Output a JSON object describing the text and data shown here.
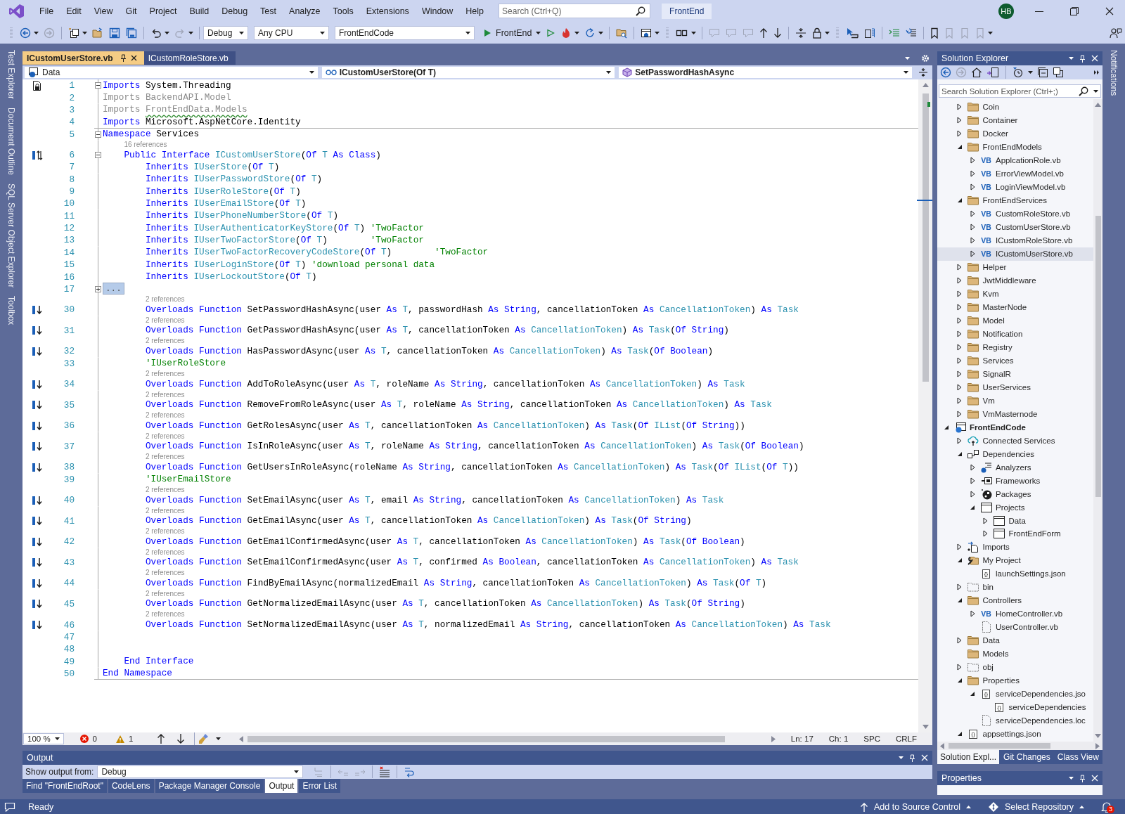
{
  "menu": [
    "File",
    "Edit",
    "View",
    "Git",
    "Project",
    "Build",
    "Debug",
    "Test",
    "Analyze",
    "Tools",
    "Extensions",
    "Window",
    "Help"
  ],
  "search": {
    "placeholder": "Search (Ctrl+Q)"
  },
  "solution_name": "FrontEnd",
  "user_initials": "HB",
  "toolbar": {
    "configuration": "Debug",
    "platform": "Any CPU",
    "startup_project": "FrontEndCode",
    "run_label": "FrontEnd"
  },
  "left_tool_tabs": [
    "Test Explorer",
    "Document Outline",
    "SQL Server Object Explorer",
    "Toolbox"
  ],
  "right_tool_tabs": [
    "Notifications"
  ],
  "document_tabs": [
    {
      "label": "ICustomUserStore.vb",
      "selected": true
    },
    {
      "label": "ICustomRoleStore.vb",
      "selected": false
    }
  ],
  "navigation_bar": {
    "project": "Data",
    "type": "ICustomUserStore(Of T)",
    "member": "SetPasswordHashAsync"
  },
  "code_lines": [
    {
      "number": "1",
      "margin_glyph": {
        "kind": "page-lock"
      },
      "expanded": true,
      "tokens": [
        {
          "kind": "keyword",
          "text": "Imports"
        },
        {
          "kind": "plain",
          "text": " System.Threading"
        }
      ]
    },
    {
      "number": "2",
      "tokens": [
        {
          "kind": "unused",
          "text": "Imports BackendAPI.Model"
        }
      ]
    },
    {
      "number": "3",
      "tokens": [
        {
          "kind": "unused",
          "text": "Imports "
        },
        {
          "kind": "unused-squiggle",
          "text": "FrontEndData.Models"
        }
      ]
    },
    {
      "number": "4",
      "tokens": [
        {
          "kind": "keyword",
          "text": "Imports"
        },
        {
          "kind": "plain",
          "text": " Microsoft.AspNetCore.Identity"
        }
      ]
    },
    {
      "number": "5",
      "expanded": true,
      "divider_above": true,
      "tokens": [
        {
          "kind": "keyword",
          "text": "Namespace"
        },
        {
          "kind": "plain",
          "text": " Services"
        }
      ]
    },
    {
      "number": "6",
      "references": "16 references",
      "margin_glyph": {
        "kind": "up-down"
      },
      "expanded": true,
      "tokens": [
        {
          "kind": "keyword",
          "text": "    Public Interface "
        },
        {
          "kind": "type",
          "text": "ICustomUserStore"
        },
        {
          "kind": "plain",
          "text": "("
        },
        {
          "kind": "keyword",
          "text": "Of "
        },
        {
          "kind": "type",
          "text": "T"
        },
        {
          "kind": "keyword",
          "text": " As Class"
        },
        {
          "kind": "plain",
          "text": ")"
        }
      ]
    },
    {
      "number": "7",
      "tokens": [
        {
          "kind": "keyword",
          "text": "        Inherits "
        },
        {
          "kind": "type",
          "text": "IUserStore"
        },
        {
          "kind": "plain",
          "text": "("
        },
        {
          "kind": "keyword",
          "text": "Of "
        },
        {
          "kind": "type",
          "text": "T"
        },
        {
          "kind": "plain",
          "text": ")"
        }
      ]
    },
    {
      "number": "8",
      "tokens": [
        {
          "kind": "keyword",
          "text": "        Inherits "
        },
        {
          "kind": "type",
          "text": "IUserPasswordStore"
        },
        {
          "kind": "plain",
          "text": "("
        },
        {
          "kind": "keyword",
          "text": "Of "
        },
        {
          "kind": "type",
          "text": "T"
        },
        {
          "kind": "plain",
          "text": ")"
        }
      ]
    },
    {
      "number": "9",
      "tokens": [
        {
          "kind": "keyword",
          "text": "        Inherits "
        },
        {
          "kind": "type",
          "text": "IUserRoleStore"
        },
        {
          "kind": "plain",
          "text": "("
        },
        {
          "kind": "keyword",
          "text": "Of "
        },
        {
          "kind": "type",
          "text": "T"
        },
        {
          "kind": "plain",
          "text": ")"
        }
      ]
    },
    {
      "number": "10",
      "tokens": [
        {
          "kind": "keyword",
          "text": "        Inherits "
        },
        {
          "kind": "type",
          "text": "IUserEmailStore"
        },
        {
          "kind": "plain",
          "text": "("
        },
        {
          "kind": "keyword",
          "text": "Of "
        },
        {
          "kind": "type",
          "text": "T"
        },
        {
          "kind": "plain",
          "text": ")"
        }
      ]
    },
    {
      "number": "11",
      "tokens": [
        {
          "kind": "keyword",
          "text": "        Inherits "
        },
        {
          "kind": "type",
          "text": "IUserPhoneNumberStore"
        },
        {
          "kind": "plain",
          "text": "("
        },
        {
          "kind": "keyword",
          "text": "Of "
        },
        {
          "kind": "type",
          "text": "T"
        },
        {
          "kind": "plain",
          "text": ")"
        }
      ]
    },
    {
      "number": "12",
      "tokens": [
        {
          "kind": "keyword",
          "text": "        Inherits "
        },
        {
          "kind": "type",
          "text": "IUserAuthenticatorKeyStore"
        },
        {
          "kind": "plain",
          "text": "("
        },
        {
          "kind": "keyword",
          "text": "Of "
        },
        {
          "kind": "type",
          "text": "T"
        },
        {
          "kind": "plain",
          "text": ") "
        },
        {
          "kind": "comment",
          "text": "'TwoFactor"
        }
      ]
    },
    {
      "number": "13",
      "tokens": [
        {
          "kind": "keyword",
          "text": "        Inherits "
        },
        {
          "kind": "type",
          "text": "IUserTwoFactorStore"
        },
        {
          "kind": "plain",
          "text": "("
        },
        {
          "kind": "keyword",
          "text": "Of "
        },
        {
          "kind": "type",
          "text": "T"
        },
        {
          "kind": "plain",
          "text": ")        "
        },
        {
          "kind": "comment",
          "text": "'TwoFactor"
        }
      ]
    },
    {
      "number": "14",
      "tokens": [
        {
          "kind": "keyword",
          "text": "        Inherits "
        },
        {
          "kind": "type",
          "text": "IUserTwoFactorRecoveryCodeStore"
        },
        {
          "kind": "plain",
          "text": "("
        },
        {
          "kind": "keyword",
          "text": "Of "
        },
        {
          "kind": "type",
          "text": "T"
        },
        {
          "kind": "plain",
          "text": ")        "
        },
        {
          "kind": "comment",
          "text": "'TwoFactor"
        }
      ]
    },
    {
      "number": "15",
      "tokens": [
        {
          "kind": "keyword",
          "text": "        Inherits "
        },
        {
          "kind": "type",
          "text": "IUserLoginStore"
        },
        {
          "kind": "plain",
          "text": "("
        },
        {
          "kind": "keyword",
          "text": "Of "
        },
        {
          "kind": "type",
          "text": "T"
        },
        {
          "kind": "plain",
          "text": ") "
        },
        {
          "kind": "comment",
          "text": "'download personal data"
        }
      ]
    },
    {
      "number": "16",
      "tokens": [
        {
          "kind": "keyword",
          "text": "        Inherits "
        },
        {
          "kind": "type",
          "text": "IUserLockoutStore"
        },
        {
          "kind": "plain",
          "text": "("
        },
        {
          "kind": "keyword",
          "text": "Of "
        },
        {
          "kind": "type",
          "text": "T"
        },
        {
          "kind": "plain",
          "text": ")"
        }
      ]
    },
    {
      "number": "17",
      "expanded": false,
      "tokens": [
        {
          "kind": "collapsed",
          "text": "..."
        }
      ]
    },
    {
      "number": "30",
      "references": "2 references",
      "margin_glyph": {
        "kind": "down"
      },
      "tokens": [
        {
          "kind": "keyword",
          "text": "        Overloads Function "
        },
        {
          "kind": "plain",
          "text": "SetPasswordHashAsync(user "
        },
        {
          "kind": "keyword",
          "text": "As "
        },
        {
          "kind": "type",
          "text": "T"
        },
        {
          "kind": "plain",
          "text": ", passwordHash "
        },
        {
          "kind": "keyword",
          "text": "As String"
        },
        {
          "kind": "plain",
          "text": ", cancellationToken "
        },
        {
          "kind": "keyword",
          "text": "As "
        },
        {
          "kind": "type",
          "text": "CancellationToken"
        },
        {
          "kind": "plain",
          "text": ") "
        },
        {
          "kind": "keyword",
          "text": "As "
        },
        {
          "kind": "type",
          "text": "Task"
        }
      ]
    },
    {
      "number": "31",
      "references": "2 references",
      "margin_glyph": {
        "kind": "down"
      },
      "tokens": [
        {
          "kind": "keyword",
          "text": "        Overloads Function "
        },
        {
          "kind": "plain",
          "text": "GetPasswordHashAsync(user "
        },
        {
          "kind": "keyword",
          "text": "As "
        },
        {
          "kind": "type",
          "text": "T"
        },
        {
          "kind": "plain",
          "text": ", cancellationToken "
        },
        {
          "kind": "keyword",
          "text": "As "
        },
        {
          "kind": "type",
          "text": "CancellationToken"
        },
        {
          "kind": "plain",
          "text": ") "
        },
        {
          "kind": "keyword",
          "text": "As "
        },
        {
          "kind": "type",
          "text": "Task"
        },
        {
          "kind": "plain",
          "text": "("
        },
        {
          "kind": "keyword",
          "text": "Of String"
        },
        {
          "kind": "plain",
          "text": ")"
        }
      ]
    },
    {
      "number": "32",
      "references": "2 references",
      "margin_glyph": {
        "kind": "down"
      },
      "tokens": [
        {
          "kind": "keyword",
          "text": "        Overloads Function "
        },
        {
          "kind": "plain",
          "text": "HasPasswordAsync(user "
        },
        {
          "kind": "keyword",
          "text": "As "
        },
        {
          "kind": "type",
          "text": "T"
        },
        {
          "kind": "plain",
          "text": ", cancellationToken "
        },
        {
          "kind": "keyword",
          "text": "As "
        },
        {
          "kind": "type",
          "text": "CancellationToken"
        },
        {
          "kind": "plain",
          "text": ") "
        },
        {
          "kind": "keyword",
          "text": "As "
        },
        {
          "kind": "type",
          "text": "Task"
        },
        {
          "kind": "plain",
          "text": "("
        },
        {
          "kind": "keyword",
          "text": "Of Boolean"
        },
        {
          "kind": "plain",
          "text": ")"
        }
      ]
    },
    {
      "number": "33",
      "tokens": [
        {
          "kind": "comment",
          "text": "        'IUserRoleStore"
        }
      ]
    },
    {
      "number": "34",
      "references": "2 references",
      "margin_glyph": {
        "kind": "down"
      },
      "tokens": [
        {
          "kind": "keyword",
          "text": "        Overloads Function "
        },
        {
          "kind": "plain",
          "text": "AddToRoleAsync(user "
        },
        {
          "kind": "keyword",
          "text": "As "
        },
        {
          "kind": "type",
          "text": "T"
        },
        {
          "kind": "plain",
          "text": ", roleName "
        },
        {
          "kind": "keyword",
          "text": "As String"
        },
        {
          "kind": "plain",
          "text": ", cancellationToken "
        },
        {
          "kind": "keyword",
          "text": "As "
        },
        {
          "kind": "type",
          "text": "CancellationToken"
        },
        {
          "kind": "plain",
          "text": ") "
        },
        {
          "kind": "keyword",
          "text": "As "
        },
        {
          "kind": "type",
          "text": "Task"
        }
      ]
    },
    {
      "number": "35",
      "references": "2 references",
      "margin_glyph": {
        "kind": "down"
      },
      "tokens": [
        {
          "kind": "keyword",
          "text": "        Overloads Function "
        },
        {
          "kind": "plain",
          "text": "RemoveFromRoleAsync(user "
        },
        {
          "kind": "keyword",
          "text": "As "
        },
        {
          "kind": "type",
          "text": "T"
        },
        {
          "kind": "plain",
          "text": ", roleName "
        },
        {
          "kind": "keyword",
          "text": "As String"
        },
        {
          "kind": "plain",
          "text": ", cancellationToken "
        },
        {
          "kind": "keyword",
          "text": "As "
        },
        {
          "kind": "type",
          "text": "CancellationToken"
        },
        {
          "kind": "plain",
          "text": ") "
        },
        {
          "kind": "keyword",
          "text": "As "
        },
        {
          "kind": "type",
          "text": "Task"
        }
      ]
    },
    {
      "number": "36",
      "references": "2 references",
      "margin_glyph": {
        "kind": "down"
      },
      "tokens": [
        {
          "kind": "keyword",
          "text": "        Overloads Function "
        },
        {
          "kind": "plain",
          "text": "GetRolesAsync(user "
        },
        {
          "kind": "keyword",
          "text": "As "
        },
        {
          "kind": "type",
          "text": "T"
        },
        {
          "kind": "plain",
          "text": ", cancellationToken "
        },
        {
          "kind": "keyword",
          "text": "As "
        },
        {
          "kind": "type",
          "text": "CancellationToken"
        },
        {
          "kind": "plain",
          "text": ") "
        },
        {
          "kind": "keyword",
          "text": "As "
        },
        {
          "kind": "type",
          "text": "Task"
        },
        {
          "kind": "plain",
          "text": "("
        },
        {
          "kind": "keyword",
          "text": "Of "
        },
        {
          "kind": "type",
          "text": "IList"
        },
        {
          "kind": "plain",
          "text": "("
        },
        {
          "kind": "keyword",
          "text": "Of String"
        },
        {
          "kind": "plain",
          "text": "))"
        }
      ]
    },
    {
      "number": "37",
      "references": "2 references",
      "margin_glyph": {
        "kind": "down"
      },
      "tokens": [
        {
          "kind": "keyword",
          "text": "        Overloads Function "
        },
        {
          "kind": "plain",
          "text": "IsInRoleAsync(user "
        },
        {
          "kind": "keyword",
          "text": "As "
        },
        {
          "kind": "type",
          "text": "T"
        },
        {
          "kind": "plain",
          "text": ", roleName "
        },
        {
          "kind": "keyword",
          "text": "As String"
        },
        {
          "kind": "plain",
          "text": ", cancellationToken "
        },
        {
          "kind": "keyword",
          "text": "As "
        },
        {
          "kind": "type",
          "text": "CancellationToken"
        },
        {
          "kind": "plain",
          "text": ") "
        },
        {
          "kind": "keyword",
          "text": "As "
        },
        {
          "kind": "type",
          "text": "Task"
        },
        {
          "kind": "plain",
          "text": "("
        },
        {
          "kind": "keyword",
          "text": "Of Boolean"
        },
        {
          "kind": "plain",
          "text": ")"
        }
      ]
    },
    {
      "number": "38",
      "references": "2 references",
      "margin_glyph": {
        "kind": "down"
      },
      "tokens": [
        {
          "kind": "keyword",
          "text": "        Overloads Function "
        },
        {
          "kind": "plain",
          "text": "GetUsersInRoleAsync(roleName "
        },
        {
          "kind": "keyword",
          "text": "As String"
        },
        {
          "kind": "plain",
          "text": ", cancellationToken "
        },
        {
          "kind": "keyword",
          "text": "As "
        },
        {
          "kind": "type",
          "text": "CancellationToken"
        },
        {
          "kind": "plain",
          "text": ") "
        },
        {
          "kind": "keyword",
          "text": "As "
        },
        {
          "kind": "type",
          "text": "Task"
        },
        {
          "kind": "plain",
          "text": "("
        },
        {
          "kind": "keyword",
          "text": "Of "
        },
        {
          "kind": "type",
          "text": "IList"
        },
        {
          "kind": "plain",
          "text": "("
        },
        {
          "kind": "keyword",
          "text": "Of "
        },
        {
          "kind": "type",
          "text": "T"
        },
        {
          "kind": "plain",
          "text": "))"
        }
      ]
    },
    {
      "number": "39",
      "tokens": [
        {
          "kind": "comment",
          "text": "        'IUserEmailStore"
        }
      ]
    },
    {
      "number": "40",
      "references": "2 references",
      "margin_glyph": {
        "kind": "down"
      },
      "tokens": [
        {
          "kind": "keyword",
          "text": "        Overloads Function "
        },
        {
          "kind": "plain",
          "text": "SetEmailAsync(user "
        },
        {
          "kind": "keyword",
          "text": "As "
        },
        {
          "kind": "type",
          "text": "T"
        },
        {
          "kind": "plain",
          "text": ", email "
        },
        {
          "kind": "keyword",
          "text": "As String"
        },
        {
          "kind": "plain",
          "text": ", cancellationToken "
        },
        {
          "kind": "keyword",
          "text": "As "
        },
        {
          "kind": "type",
          "text": "CancellationToken"
        },
        {
          "kind": "plain",
          "text": ") "
        },
        {
          "kind": "keyword",
          "text": "As "
        },
        {
          "kind": "type",
          "text": "Task"
        }
      ]
    },
    {
      "number": "41",
      "references": "2 references",
      "margin_glyph": {
        "kind": "down"
      },
      "tokens": [
        {
          "kind": "keyword",
          "text": "        Overloads Function "
        },
        {
          "kind": "plain",
          "text": "GetEmailAsync(user "
        },
        {
          "kind": "keyword",
          "text": "As "
        },
        {
          "kind": "type",
          "text": "T"
        },
        {
          "kind": "plain",
          "text": ", cancellationToken "
        },
        {
          "kind": "keyword",
          "text": "As "
        },
        {
          "kind": "type",
          "text": "CancellationToken"
        },
        {
          "kind": "plain",
          "text": ") "
        },
        {
          "kind": "keyword",
          "text": "As "
        },
        {
          "kind": "type",
          "text": "Task"
        },
        {
          "kind": "plain",
          "text": "("
        },
        {
          "kind": "keyword",
          "text": "Of String"
        },
        {
          "kind": "plain",
          "text": ")"
        }
      ]
    },
    {
      "number": "42",
      "references": "2 references",
      "margin_glyph": {
        "kind": "down"
      },
      "tokens": [
        {
          "kind": "keyword",
          "text": "        Overloads Function "
        },
        {
          "kind": "plain",
          "text": "GetEmailConfirmedAsync(user "
        },
        {
          "kind": "keyword",
          "text": "As "
        },
        {
          "kind": "type",
          "text": "T"
        },
        {
          "kind": "plain",
          "text": ", cancellationToken "
        },
        {
          "kind": "keyword",
          "text": "As "
        },
        {
          "kind": "type",
          "text": "CancellationToken"
        },
        {
          "kind": "plain",
          "text": ") "
        },
        {
          "kind": "keyword",
          "text": "As "
        },
        {
          "kind": "type",
          "text": "Task"
        },
        {
          "kind": "plain",
          "text": "("
        },
        {
          "kind": "keyword",
          "text": "Of Boolean"
        },
        {
          "kind": "plain",
          "text": ")"
        }
      ]
    },
    {
      "number": "43",
      "references": "2 references",
      "margin_glyph": {
        "kind": "down"
      },
      "tokens": [
        {
          "kind": "keyword",
          "text": "        Overloads Function "
        },
        {
          "kind": "plain",
          "text": "SetEmailConfirmedAsync(user "
        },
        {
          "kind": "keyword",
          "text": "As "
        },
        {
          "kind": "type",
          "text": "T"
        },
        {
          "kind": "plain",
          "text": ", confirmed "
        },
        {
          "kind": "keyword",
          "text": "As Boolean"
        },
        {
          "kind": "plain",
          "text": ", cancellationToken "
        },
        {
          "kind": "keyword",
          "text": "As "
        },
        {
          "kind": "type",
          "text": "CancellationToken"
        },
        {
          "kind": "plain",
          "text": ") "
        },
        {
          "kind": "keyword",
          "text": "As "
        },
        {
          "kind": "type",
          "text": "Task"
        }
      ]
    },
    {
      "number": "44",
      "references": "2 references",
      "margin_glyph": {
        "kind": "down"
      },
      "tokens": [
        {
          "kind": "keyword",
          "text": "        Overloads Function "
        },
        {
          "kind": "plain",
          "text": "FindByEmailAsync(normalizedEmail "
        },
        {
          "kind": "keyword",
          "text": "As String"
        },
        {
          "kind": "plain",
          "text": ", cancellationToken "
        },
        {
          "kind": "keyword",
          "text": "As "
        },
        {
          "kind": "type",
          "text": "CancellationToken"
        },
        {
          "kind": "plain",
          "text": ") "
        },
        {
          "kind": "keyword",
          "text": "As "
        },
        {
          "kind": "type",
          "text": "Task"
        },
        {
          "kind": "plain",
          "text": "("
        },
        {
          "kind": "keyword",
          "text": "Of "
        },
        {
          "kind": "type",
          "text": "T"
        },
        {
          "kind": "plain",
          "text": ")"
        }
      ]
    },
    {
      "number": "45",
      "references": "2 references",
      "margin_glyph": {
        "kind": "down"
      },
      "tokens": [
        {
          "kind": "keyword",
          "text": "        Overloads Function "
        },
        {
          "kind": "plain",
          "text": "GetNormalizedEmailAsync(user "
        },
        {
          "kind": "keyword",
          "text": "As "
        },
        {
          "kind": "type",
          "text": "T"
        },
        {
          "kind": "plain",
          "text": ", cancellationToken "
        },
        {
          "kind": "keyword",
          "text": "As "
        },
        {
          "kind": "type",
          "text": "CancellationToken"
        },
        {
          "kind": "plain",
          "text": ") "
        },
        {
          "kind": "keyword",
          "text": "As "
        },
        {
          "kind": "type",
          "text": "Task"
        },
        {
          "kind": "plain",
          "text": "("
        },
        {
          "kind": "keyword",
          "text": "Of String"
        },
        {
          "kind": "plain",
          "text": ")"
        }
      ]
    },
    {
      "number": "46",
      "references": "2 references",
      "margin_glyph": {
        "kind": "down"
      },
      "tokens": [
        {
          "kind": "keyword",
          "text": "        Overloads Function "
        },
        {
          "kind": "plain",
          "text": "SetNormalizedEmailAsync(user "
        },
        {
          "kind": "keyword",
          "text": "As "
        },
        {
          "kind": "type",
          "text": "T"
        },
        {
          "kind": "plain",
          "text": ", normalizedEmail "
        },
        {
          "kind": "keyword",
          "text": "As String"
        },
        {
          "kind": "plain",
          "text": ", cancellationToken "
        },
        {
          "kind": "keyword",
          "text": "As "
        },
        {
          "kind": "type",
          "text": "CancellationToken"
        },
        {
          "kind": "plain",
          "text": ") "
        },
        {
          "kind": "keyword",
          "text": "As "
        },
        {
          "kind": "type",
          "text": "Task"
        }
      ]
    },
    {
      "number": "47"
    },
    {
      "number": "48"
    },
    {
      "number": "49",
      "tokens": [
        {
          "kind": "keyword",
          "text": "    End Interface"
        }
      ]
    },
    {
      "number": "50",
      "divider_below": true,
      "tokens": [
        {
          "kind": "keyword",
          "text": "End Namespace"
        }
      ]
    }
  ],
  "editor_status": {
    "zoom": "100 %",
    "errors": "0",
    "warnings": "1",
    "line": "Ln: 17",
    "column": "Ch: 1",
    "whitespace": "SPC",
    "line_endings": "CRLF"
  },
  "output": {
    "title": "Output",
    "source_label": "Show output from:",
    "source": "Debug",
    "tabs": [
      {
        "label": "Find \"FrontEndRoot\"",
        "selected": false
      },
      {
        "label": "CodeLens",
        "selected": false
      },
      {
        "label": "Package Manager Console",
        "selected": false
      },
      {
        "label": "Output",
        "selected": true
      },
      {
        "label": "Error List",
        "selected": false
      }
    ]
  },
  "solution_explorer": {
    "title": "Solution Explorer",
    "search": {
      "placeholder": "Search Solution Explorer (Ctrl+;)"
    },
    "tree": [
      {
        "children": [
          {
            "label": "Coin",
            "kind": "folder",
            "expanded": false,
            "selected": false
          },
          {
            "label": "Container",
            "kind": "folder",
            "expanded": false,
            "selected": false
          },
          {
            "label": "Docker",
            "kind": "folder",
            "expanded": false,
            "selected": false
          },
          {
            "label": "FrontEndModels",
            "kind": "folder",
            "expanded": true,
            "selected": false,
            "children": [
              {
                "label": "ApplcationRole.vb",
                "kind": "vb-file",
                "badge": "VB",
                "expanded": false,
                "selected": false
              },
              {
                "label": "ErrorViewModel.vb",
                "kind": "vb-file",
                "badge": "VB",
                "expanded": false,
                "selected": false
              },
              {
                "label": "LoginViewModel.vb",
                "kind": "vb-file",
                "badge": "VB",
                "expanded": false,
                "selected": false
              }
            ]
          },
          {
            "label": "FrontEndServices",
            "kind": "folder",
            "expanded": true,
            "selected": false,
            "children": [
              {
                "label": "CustomRoleStore.vb",
                "kind": "vb-file",
                "badge": "VB",
                "expanded": false,
                "selected": false
              },
              {
                "label": "CustomUserStore.vb",
                "kind": "vb-file",
                "badge": "VB",
                "expanded": false,
                "selected": false
              },
              {
                "label": "ICustomRoleStore.vb",
                "kind": "vb-file",
                "badge": "VB",
                "expanded": false,
                "selected": false
              },
              {
                "label": "ICustomUserStore.vb",
                "kind": "vb-file",
                "badge": "VB",
                "expanded": false,
                "selected": true
              }
            ]
          },
          {
            "label": "Helper",
            "kind": "folder",
            "expanded": false,
            "selected": false
          },
          {
            "label": "JwtMiddleware",
            "kind": "folder",
            "expanded": false,
            "selected": false
          },
          {
            "label": "Kvm",
            "kind": "folder",
            "expanded": false,
            "selected": false
          },
          {
            "label": "MasterNode",
            "kind": "folder",
            "expanded": false,
            "selected": false
          },
          {
            "label": "Model",
            "kind": "folder",
            "expanded": false,
            "selected": false
          },
          {
            "label": "Notification",
            "kind": "folder",
            "expanded": false,
            "selected": false
          },
          {
            "label": "Registry",
            "kind": "folder",
            "expanded": false,
            "selected": false
          },
          {
            "label": "Services",
            "kind": "folder",
            "expanded": false,
            "selected": false
          },
          {
            "label": "SignalR",
            "kind": "folder",
            "expanded": false,
            "selected": false
          },
          {
            "label": "UserServices",
            "kind": "folder",
            "expanded": false,
            "selected": false
          },
          {
            "label": "Vm",
            "kind": "folder",
            "expanded": false,
            "selected": false
          },
          {
            "label": "VmMasternode",
            "kind": "folder",
            "expanded": false,
            "selected": false
          }
        ]
      },
      {
        "label": "FrontEndCode",
        "kind": "project",
        "expanded": true,
        "selected": false,
        "children": [
          {
            "label": "Connected Services",
            "kind": "connected-services",
            "expanded": false,
            "selected": false
          },
          {
            "label": "Dependencies",
            "kind": "dependencies",
            "expanded": true,
            "selected": false,
            "children": [
              {
                "label": "Analyzers",
                "kind": "analyzers",
                "expanded": false,
                "selected": false
              },
              {
                "label": "Frameworks",
                "kind": "frameworks",
                "expanded": false,
                "selected": false
              },
              {
                "label": "Packages",
                "kind": "packages",
                "expanded": false,
                "selected": false
              },
              {
                "label": "Projects",
                "kind": "project-group",
                "expanded": true,
                "selected": false,
                "children": [
                  {
                    "label": "Data",
                    "kind": "project-reference",
                    "expanded": false,
                    "selected": false
                  },
                  {
                    "label": "FrontEndForm",
                    "kind": "project-reference",
                    "expanded": false,
                    "selected": false
                  }
                ]
              }
            ]
          },
          {
            "label": "Imports",
            "kind": "imports",
            "expanded": false,
            "selected": false
          },
          {
            "label": "My Project",
            "kind": "my-project",
            "expanded": true,
            "selected": false,
            "children": [
              {
                "label": "launchSettings.json",
                "kind": "json-file",
                "badge": "{}",
                "selected": false
              }
            ]
          },
          {
            "label": "bin",
            "kind": "excluded-folder",
            "expanded": false,
            "selected": false
          },
          {
            "label": "Controllers",
            "kind": "folder",
            "expanded": true,
            "selected": false,
            "children": [
              {
                "label": "HomeController.vb",
                "kind": "vb-file",
                "badge": "VB",
                "expanded": false,
                "selected": false
              },
              {
                "label": "UserController.vb",
                "kind": "excluded-file",
                "selected": false
              }
            ]
          },
          {
            "label": "Data",
            "kind": "folder",
            "expanded": false,
            "selected": false
          },
          {
            "label": "Models",
            "kind": "folder",
            "selected": false
          },
          {
            "label": "obj",
            "kind": "excluded-folder",
            "expanded": false,
            "selected": false
          },
          {
            "label": "Properties",
            "kind": "folder",
            "expanded": true,
            "selected": false,
            "children": [
              {
                "label": "serviceDependencies.jso",
                "kind": "json-file",
                "badge": "{}",
                "expanded": true,
                "selected": false,
                "children": [
                  {
                    "label": "serviceDependencies",
                    "kind": "json-file",
                    "badge": "{}",
                    "selected": false
                  }
                ]
              },
              {
                "label": "serviceDependencies.loc",
                "kind": "excluded-file",
                "selected": false
              }
            ]
          },
          {
            "label": "appsettings.json",
            "kind": "json-file",
            "badge": "{}",
            "expanded": true,
            "selected": false
          }
        ]
      }
    ],
    "tabs": [
      {
        "label": "Solution Expl...",
        "selected": true
      },
      {
        "label": "Git Changes",
        "selected": false
      },
      {
        "label": "Class View",
        "selected": false
      }
    ]
  },
  "properties": {
    "title": "Properties"
  },
  "status_bar": {
    "message": "Ready",
    "source_control": "Add to Source Control",
    "repository": "Select Repository",
    "notifications": "3"
  }
}
